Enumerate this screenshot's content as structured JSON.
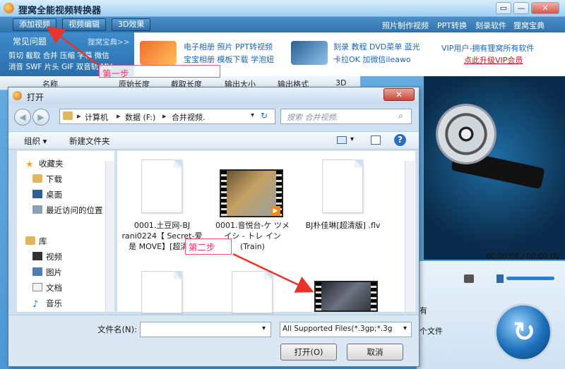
{
  "app": {
    "title": "狸窝全能视频转换器",
    "controls": {
      "restore": "▭",
      "minimize": "—",
      "close": "✕"
    }
  },
  "toolbar": {
    "add_video": "添加视频",
    "edit_video": "视频编辑",
    "effect_3d": "3D效果"
  },
  "top_links": [
    "照片制作视频",
    "PPT转换",
    "刻录软件",
    "狸窝宝典"
  ],
  "promo": {
    "faq": "常见问题",
    "baodian": "狸窝宝典>>",
    "keywords_row1": "剪切 截取 合并 压缩 字幕 微信",
    "keywords_row2": "消音 SWF 片头 GIF 双音轨 MV",
    "mid_row1": "电子相册 照片 PPT转视频",
    "mid_row2": "宝宝相册 模板下载 学泡妞",
    "right_row1": "刻录 教程 DVD菜单 蓝光",
    "right_row2": "卡拉OK 加微信ileawo",
    "vip_text": "VIP用户-拥有狸窝所有软件",
    "vip_link": "点此升级VIP会员"
  },
  "columns": [
    "名称",
    "原始长度",
    "截取长度",
    "输出大小",
    "输出格式",
    "3D"
  ],
  "preview": {
    "time": "00:00:00 / 00:00:00",
    "side_text_1": "有",
    "side_text_2": "个文件"
  },
  "annotations": {
    "step1": "第一步",
    "step2": "第二步"
  },
  "dialog": {
    "title": "打开",
    "close": "✕",
    "path": [
      "计算机",
      "数据 (F:)",
      "合并视频."
    ],
    "search_placeholder": "搜索 合并视频.",
    "organize": "组织 ▾",
    "new_folder": "新建文件夹",
    "nav": {
      "favorites": "收藏夹",
      "downloads": "下载",
      "desktop": "桌面",
      "recent": "最近访问的位置",
      "libraries": "库",
      "videos": "视频",
      "pictures": "图片",
      "documents": "文档",
      "music": "音乐"
    },
    "files": [
      {
        "name": "0001.土豆网-BJ rani0224【 Secret-爱是 MOVE】[超清..."
      },
      {
        "name": "0001.音悦台-ケ ツメイシ - トレ イン (Train)"
      },
      {
        "name": "BJ朴佳琳[超清版] .flv"
      }
    ],
    "filename_label": "文件名(N):",
    "filename_value": "",
    "filter": "All Supported Files(*.3gp;*.3g",
    "open_button": "打开(O)",
    "cancel_button": "取消"
  }
}
